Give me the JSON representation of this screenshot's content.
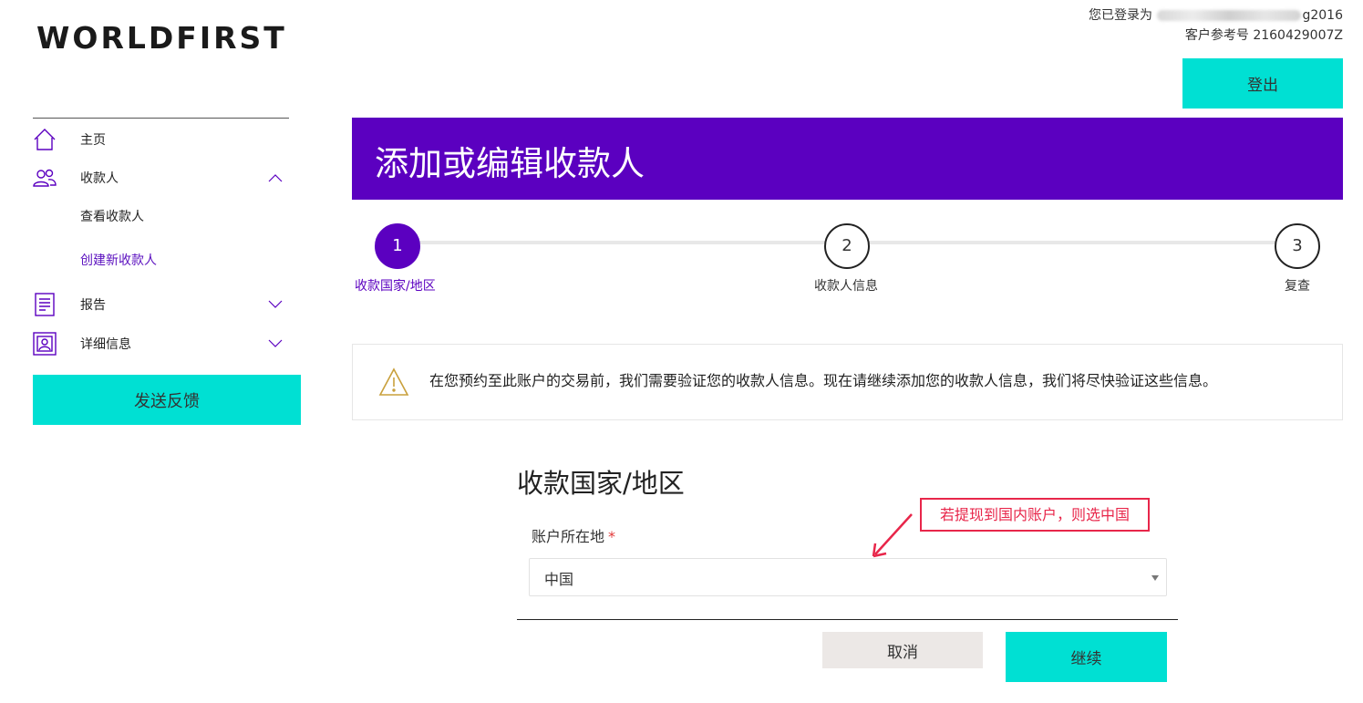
{
  "header": {
    "logo_text": "WORLDFIRST",
    "logged_in_prefix": "您已登录为",
    "logged_in_suffix": "g2016",
    "customer_ref_label": "客户参考号",
    "customer_ref_value": "2160429007Z",
    "logout_label": "登出"
  },
  "sidebar": {
    "items": [
      {
        "label": "主页",
        "icon": "home-icon"
      },
      {
        "label": "收款人",
        "icon": "people-icon",
        "expanded": true
      },
      {
        "label": "报告",
        "icon": "report-icon"
      },
      {
        "label": "详细信息",
        "icon": "profile-icon"
      }
    ],
    "sub_items": [
      {
        "label": "查看收款人",
        "active": false
      },
      {
        "label": "创建新收款人",
        "active": true
      }
    ],
    "feedback_label": "发送反馈"
  },
  "banner": {
    "title": "添加或编辑收款人"
  },
  "stepper": {
    "steps": [
      {
        "number": "1",
        "label": "收款国家/地区",
        "active": true
      },
      {
        "number": "2",
        "label": "收款人信息",
        "active": false
      },
      {
        "number": "3",
        "label": "复查",
        "active": false
      }
    ]
  },
  "notice": {
    "icon": "warning-icon",
    "text": "在您预约至此账户的交易前，我们需要验证您的收款人信息。现在请继续添加您的收款人信息，我们将尽快验证这些信息。"
  },
  "form": {
    "title": "收款国家/地区",
    "field_label": "账户所在地",
    "required_mark": "*",
    "selected_value": "中国",
    "cancel_label": "取消",
    "continue_label": "继续"
  },
  "annotation": {
    "text": "若提现到国内账户，则选中国"
  },
  "colors": {
    "brand_purple": "#5b00c0",
    "accent_teal": "#00e0d3",
    "annotation_red": "#e8264a"
  }
}
